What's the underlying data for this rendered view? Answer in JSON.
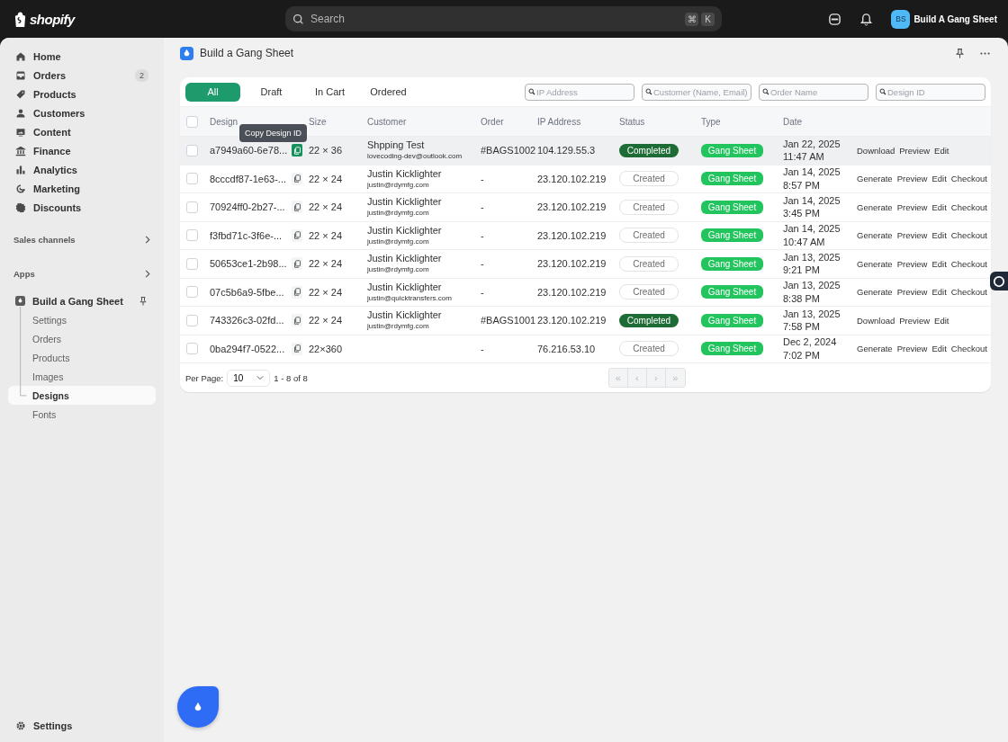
{
  "topbar": {
    "logo": "shopify",
    "search": {
      "placeholder": "Search",
      "keys": [
        "⌘",
        "K"
      ]
    },
    "store": {
      "initials": "BS",
      "name": "Build A Gang Sheet"
    }
  },
  "sidebar": {
    "items": [
      {
        "label": "Home",
        "selected": false
      },
      {
        "label": "Orders",
        "selected": false,
        "badge": "2"
      },
      {
        "label": "Products",
        "selected": false
      },
      {
        "label": "Customers",
        "selected": false
      },
      {
        "label": "Content",
        "selected": false
      },
      {
        "label": "Finance",
        "selected": false
      },
      {
        "label": "Analytics",
        "selected": false
      },
      {
        "label": "Marketing",
        "selected": false
      },
      {
        "label": "Discounts",
        "selected": false
      }
    ],
    "sections": [
      "Sales channels",
      "Apps"
    ],
    "app": {
      "name": "Build a Gang Sheet",
      "children": [
        {
          "label": "Settings",
          "selected": false
        },
        {
          "label": "Orders",
          "selected": false
        },
        {
          "label": "Products",
          "selected": false
        },
        {
          "label": "Images",
          "selected": false
        },
        {
          "label": "Designs",
          "selected": true
        },
        {
          "label": "Fonts",
          "selected": false
        }
      ]
    },
    "footer": "Settings"
  },
  "page": {
    "title": "Build a Gang Sheet"
  },
  "tabs": [
    {
      "label": "All",
      "selected": true
    },
    {
      "label": "Draft",
      "selected": false
    },
    {
      "label": "In Cart",
      "selected": false
    },
    {
      "label": "Ordered",
      "selected": false
    }
  ],
  "filters": [
    {
      "placeholder": "IP Address"
    },
    {
      "placeholder": "Customer (Name, Email)"
    },
    {
      "placeholder": "Order Name"
    },
    {
      "placeholder": "Design ID"
    }
  ],
  "table": {
    "select_all": {
      "checked": false
    },
    "columns": [
      "Design",
      "Size",
      "Customer",
      "Order",
      "IP Address",
      "Status",
      "Type",
      "Date"
    ],
    "rows": [
      {
        "checked": false,
        "hovered": true,
        "design": "a7949a60-6e78...",
        "copy_tooltip": "Copy Design ID",
        "size": "22 × 36",
        "customer": "Shpping Test",
        "email": "lovecoding-dev@outlook.com",
        "order": "#BAGS1002",
        "ip": "104.129.55.3",
        "status": {
          "label": "Completed",
          "kind": "completed"
        },
        "type": "Gang Sheet",
        "date": "Jan 22, 2025",
        "time": "11:47 AM",
        "actions": [
          "Download",
          "Preview",
          "Edit"
        ]
      },
      {
        "checked": false,
        "hovered": false,
        "design": "8cccdf87-1e63-...",
        "size": "22 × 24",
        "customer": "Justin Kicklighter",
        "email": "justin@rdymfg.com",
        "order": "-",
        "ip": "23.120.102.219",
        "status": {
          "label": "Created",
          "kind": "created"
        },
        "type": "Gang Sheet",
        "date": "Jan 14, 2025",
        "time": "8:57 PM",
        "actions": [
          "Generate",
          "Preview",
          "Edit",
          "Checkout"
        ]
      },
      {
        "checked": false,
        "hovered": false,
        "design": "70924ff0-2b27-...",
        "size": "22 × 24",
        "customer": "Justin Kicklighter",
        "email": "justin@rdymfg.com",
        "order": "-",
        "ip": "23.120.102.219",
        "status": {
          "label": "Created",
          "kind": "created"
        },
        "type": "Gang Sheet",
        "date": "Jan 14, 2025",
        "time": "3:45 PM",
        "actions": [
          "Generate",
          "Preview",
          "Edit",
          "Checkout"
        ]
      },
      {
        "checked": false,
        "hovered": false,
        "design": "f3fbd71c-3f6e-...",
        "size": "22 × 24",
        "customer": "Justin Kicklighter",
        "email": "justin@rdymfg.com",
        "order": "-",
        "ip": "23.120.102.219",
        "status": {
          "label": "Created",
          "kind": "created"
        },
        "type": "Gang Sheet",
        "date": "Jan 14, 2025",
        "time": "10:47 AM",
        "actions": [
          "Generate",
          "Preview",
          "Edit",
          "Checkout"
        ]
      },
      {
        "checked": false,
        "hovered": false,
        "design": "50653ce1-2b98...",
        "size": "22 × 24",
        "customer": "Justin Kicklighter",
        "email": "justin@rdymfg.com",
        "order": "-",
        "ip": "23.120.102.219",
        "status": {
          "label": "Created",
          "kind": "created"
        },
        "type": "Gang Sheet",
        "date": "Jan 13, 2025",
        "time": "9:21 PM",
        "actions": [
          "Generate",
          "Preview",
          "Edit",
          "Checkout"
        ]
      },
      {
        "checked": false,
        "hovered": false,
        "design": "07c5b6a9-5fbe...",
        "size": "22 × 24",
        "customer": "Justin Kicklighter",
        "email": "justin@quicktransfers.com",
        "order": "-",
        "ip": "23.120.102.219",
        "status": {
          "label": "Created",
          "kind": "created"
        },
        "type": "Gang Sheet",
        "date": "Jan 13, 2025",
        "time": "8:38 PM",
        "actions": [
          "Generate",
          "Preview",
          "Edit",
          "Checkout"
        ]
      },
      {
        "checked": false,
        "hovered": false,
        "design": "743326c3-02fd...",
        "size": "22 × 24",
        "customer": "Justin Kicklighter",
        "email": "justin@rdymfg.com",
        "order": "#BAGS1001",
        "ip": "23.120.102.219",
        "status": {
          "label": "Completed",
          "kind": "completed"
        },
        "type": "Gang Sheet",
        "date": "Jan 13, 2025",
        "time": "7:58 PM",
        "actions": [
          "Download",
          "Preview",
          "Edit"
        ]
      },
      {
        "checked": false,
        "hovered": false,
        "design": "0ba294f7-0522...",
        "size": "22×360",
        "order": "-",
        "ip": "76.216.53.10",
        "status": {
          "label": "Created",
          "kind": "created"
        },
        "type": "Gang Sheet",
        "date": "Dec 2, 2024",
        "time": "7:02 PM",
        "actions": [
          "Generate",
          "Preview",
          "Edit",
          "Checkout"
        ]
      }
    ]
  },
  "pagination": {
    "label": "Per Page:",
    "per_page": "10",
    "range": "1 - 8 of 8",
    "buttons": [
      {
        "label": "«",
        "disabled": true
      },
      {
        "label": "‹",
        "disabled": true
      },
      {
        "label": "›",
        "disabled": true
      },
      {
        "label": "»",
        "disabled": true
      }
    ]
  }
}
